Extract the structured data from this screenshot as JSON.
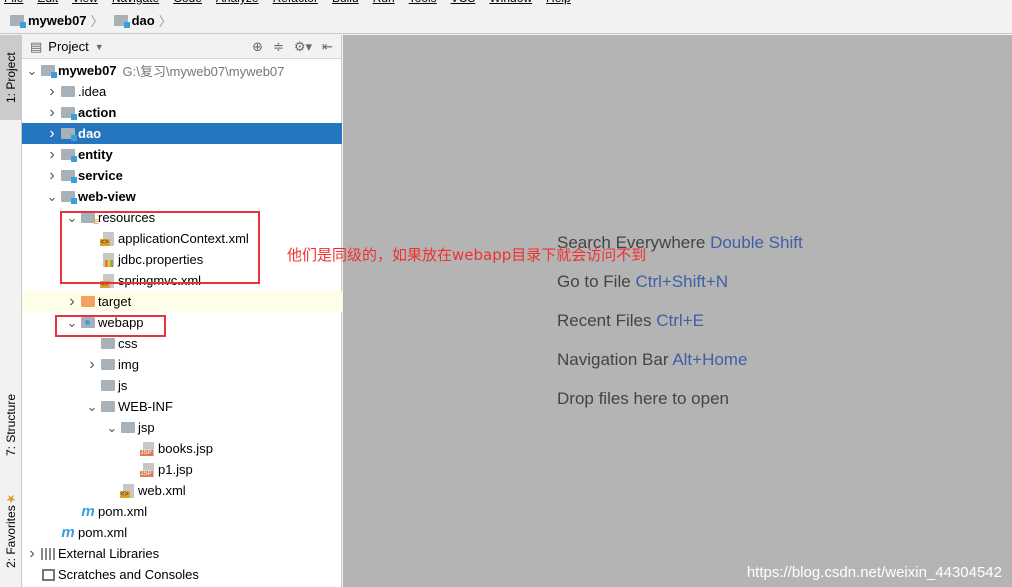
{
  "menu": [
    "File",
    "Edit",
    "View",
    "Navigate",
    "Code",
    "Analyze",
    "Refactor",
    "Build",
    "Run",
    "Tools",
    "VCS",
    "Window",
    "Help"
  ],
  "breadcrumb": [
    "myweb07",
    "dao"
  ],
  "side_tabs": {
    "project": "1: Project",
    "structure": "7: Structure",
    "favorites": "2: Favorites"
  },
  "panel": {
    "title": "Project"
  },
  "tree": [
    {
      "label": "myweb07",
      "path": "G:\\复习\\myweb07\\myweb07",
      "level": 0,
      "arrow": "down",
      "icon": "folder-module",
      "bold": true
    },
    {
      "label": ".idea",
      "level": 1,
      "arrow": "right",
      "icon": "folder"
    },
    {
      "label": "action",
      "level": 1,
      "arrow": "right",
      "icon": "folder-module",
      "bold": true
    },
    {
      "label": "dao",
      "level": 1,
      "arrow": "right",
      "icon": "folder-module",
      "bold": true,
      "selected": true
    },
    {
      "label": "entity",
      "level": 1,
      "arrow": "right",
      "icon": "folder-module",
      "bold": true
    },
    {
      "label": "service",
      "level": 1,
      "arrow": "right",
      "icon": "folder-module",
      "bold": true
    },
    {
      "label": "web-view",
      "level": 1,
      "arrow": "down",
      "icon": "folder-module",
      "bold": true
    },
    {
      "label": "resources",
      "level": 2,
      "arrow": "down",
      "icon": "folder-resources"
    },
    {
      "label": "applicationContext.xml",
      "level": 3,
      "icon": "xml-file"
    },
    {
      "label": "jdbc.properties",
      "level": 3,
      "icon": "properties-file"
    },
    {
      "label": "springmvc.xml",
      "level": 3,
      "icon": "xml-file"
    },
    {
      "label": "target",
      "level": 2,
      "arrow": "right",
      "icon": "folder-excluded",
      "highlight": true
    },
    {
      "label": "webapp",
      "level": 2,
      "arrow": "down",
      "icon": "folder-web"
    },
    {
      "label": "css",
      "level": 3,
      "icon": "folder"
    },
    {
      "label": "img",
      "level": 3,
      "arrow": "right",
      "icon": "folder"
    },
    {
      "label": "js",
      "level": 3,
      "icon": "folder"
    },
    {
      "label": "WEB-INF",
      "level": 3,
      "arrow": "down",
      "icon": "folder"
    },
    {
      "label": "jsp",
      "level": 4,
      "arrow": "down",
      "icon": "folder"
    },
    {
      "label": "books.jsp",
      "level": 5,
      "icon": "jsp-file"
    },
    {
      "label": "p1.jsp",
      "level": 5,
      "icon": "jsp-file"
    },
    {
      "label": "web.xml",
      "level": 4,
      "icon": "web-xml-file"
    },
    {
      "label": "pom.xml",
      "level": 2,
      "icon": "maven-file"
    },
    {
      "label": "pom.xml",
      "level": 1,
      "icon": "maven-file"
    },
    {
      "label": "External Libraries",
      "level": 0,
      "arrow": "right",
      "icon": "libraries"
    },
    {
      "label": "Scratches and Consoles",
      "level": 0,
      "icon": "scratches"
    }
  ],
  "annotation": "他们是同级的，如果放在webapp目录下就会访问不到",
  "hints": [
    {
      "text": "Search Everywhere",
      "key": "Double Shift"
    },
    {
      "text": "Go to File",
      "key": "Ctrl+Shift+N"
    },
    {
      "text": "Recent Files",
      "key": "Ctrl+E"
    },
    {
      "text": "Navigation Bar",
      "key": "Alt+Home"
    },
    {
      "text": "Drop files here to open",
      "key": ""
    }
  ],
  "watermark": "https://blog.csdn.net/weixin_44304542",
  "colors": {
    "selection": "#2675bf",
    "annotation": "#e8323c",
    "shortcut": "#3f5fa6",
    "editor_bg": "#b4b4b4"
  }
}
